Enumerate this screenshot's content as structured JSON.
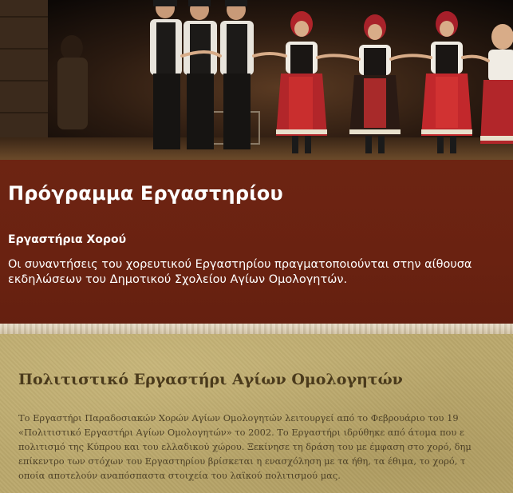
{
  "hero": {
    "image_icon": "greek-folk-dancers-photo"
  },
  "program": {
    "title": "Πρόγραμμα Εργαστηρίου",
    "subtitle": "Εργαστήρια Χορού",
    "text": "Οι συναντήσεις του χορευτικού Εργαστηρίου πραγματοποιούνται στην αίθουσα εκδηλώσεων του Δημοτικού Σχολείου Αγίων Ομολογητών."
  },
  "culture": {
    "title": "Πολιτιστικό Εργαστήρι Αγίων Ομολογητών",
    "lines": [
      " Το Εργαστήρι Παραδοσιακών Χορών Αγίων Ομολογητών λειτουργεί από το Φεβρουάριο του 19",
      "«Πολιτιστικό Εργαστήρι Αγίων Ομολογητών» το 2002. Το Εργαστήρι ιδρύθηκε από άτομα που ε",
      "πολιτισμό της Κύπρου και του ελλαδικού χώρου. Ξεκίνησε τη δράση του με έμφαση στο χορό, δημ",
      "επίκεντρο των στόχων του Εργαστηρίου βρίσκεται η ενασχόληση με τα ήθη, τα έθιμα, το χορό, τ",
      "οποία αποτελούν αναπόσπαστα στοιχεία του λαϊκού πολιτισμού μας."
    ]
  },
  "colors": {
    "program_band": "#6b2110",
    "parchment": "#bba86c",
    "culture_title": "#4a3a1c",
    "culture_text": "#4d4127"
  }
}
